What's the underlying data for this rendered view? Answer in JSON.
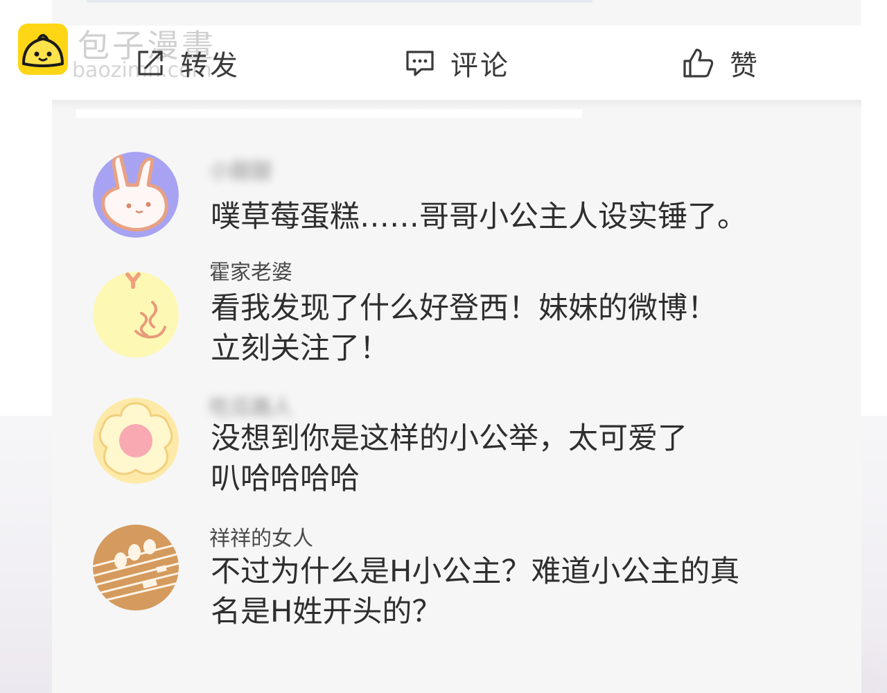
{
  "watermark": {
    "site_name": "包子漫畫",
    "url": "baozimh.com"
  },
  "actions": {
    "repost_label": "转发",
    "comment_label": "评论",
    "like_label": "赞"
  },
  "comments": [
    {
      "username": "小甜甜",
      "username_blurred": true,
      "lines": [
        "噗草莓蛋糕……哥哥小公主人设实锤了。"
      ],
      "avatar_icon": "bunny-avatar"
    },
    {
      "username": "霍家老婆",
      "username_blurred": false,
      "lines": [
        "看我发现了什么好登西！妹妹的微博！",
        "立刻关注了！"
      ],
      "avatar_icon": "yellow-doodle-avatar"
    },
    {
      "username": "吃瓜路人",
      "username_blurred": true,
      "lines": [
        "没想到你是这样的小公举，太可爱了",
        "叭哈哈哈哈"
      ],
      "avatar_icon": "flower-avatar"
    },
    {
      "username": "祥祥的女人",
      "username_blurred": false,
      "lines": [
        "不过为什么是H小公主？难道小公主的真",
        "名是H姓开头的？"
      ],
      "avatar_icon": "music-score-avatar"
    }
  ],
  "colors": {
    "logo_yellow": "#ffd615",
    "text": "#2e2e2e",
    "panel": "#f6f6f6"
  }
}
